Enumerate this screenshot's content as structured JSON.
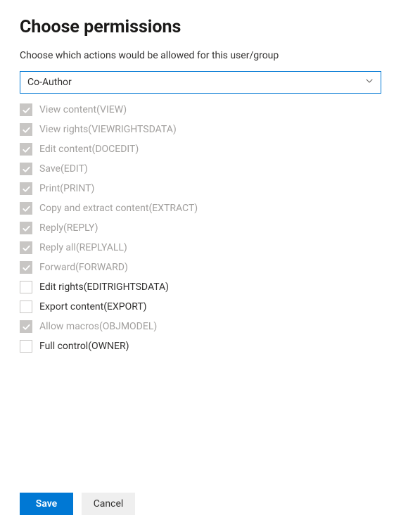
{
  "header": {
    "title": "Choose permissions",
    "subtitle": "Choose which actions would be allowed for this user/group"
  },
  "dropdown": {
    "selected": "Co-Author"
  },
  "permissions": [
    {
      "label": "View content(VIEW)",
      "checked": true,
      "disabled": true
    },
    {
      "label": "View rights(VIEWRIGHTSDATA)",
      "checked": true,
      "disabled": true
    },
    {
      "label": "Edit content(DOCEDIT)",
      "checked": true,
      "disabled": true
    },
    {
      "label": "Save(EDIT)",
      "checked": true,
      "disabled": true
    },
    {
      "label": "Print(PRINT)",
      "checked": true,
      "disabled": true
    },
    {
      "label": "Copy and extract content(EXTRACT)",
      "checked": true,
      "disabled": true
    },
    {
      "label": "Reply(REPLY)",
      "checked": true,
      "disabled": true
    },
    {
      "label": "Reply all(REPLYALL)",
      "checked": true,
      "disabled": true
    },
    {
      "label": "Forward(FORWARD)",
      "checked": true,
      "disabled": true
    },
    {
      "label": "Edit rights(EDITRIGHTSDATA)",
      "checked": false,
      "disabled": false
    },
    {
      "label": "Export content(EXPORT)",
      "checked": false,
      "disabled": false
    },
    {
      "label": "Allow macros(OBJMODEL)",
      "checked": true,
      "disabled": true
    },
    {
      "label": "Full control(OWNER)",
      "checked": false,
      "disabled": false
    }
  ],
  "buttons": {
    "save": "Save",
    "cancel": "Cancel"
  }
}
